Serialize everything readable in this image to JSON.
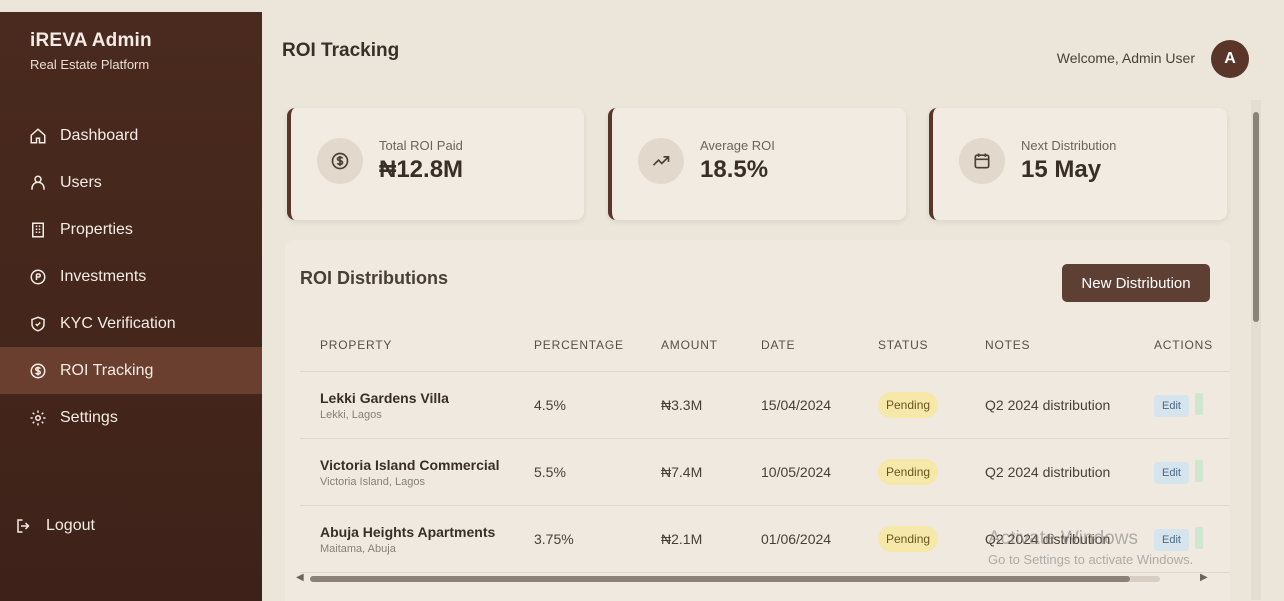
{
  "sidebar": {
    "brand_title": "iREVA Admin",
    "brand_subtitle": "Real Estate Platform",
    "items": [
      {
        "label": "Dashboard",
        "icon": "home-icon"
      },
      {
        "label": "Users",
        "icon": "users-icon"
      },
      {
        "label": "Properties",
        "icon": "building-icon"
      },
      {
        "label": "Investments",
        "icon": "coin-icon"
      },
      {
        "label": "KYC Verification",
        "icon": "shield-icon"
      },
      {
        "label": "ROI Tracking",
        "icon": "dollar-circle-icon",
        "active": true
      },
      {
        "label": "Settings",
        "icon": "gear-icon"
      }
    ],
    "logout_label": "Logout"
  },
  "header": {
    "title": "ROI Tracking",
    "welcome": "Welcome, Admin User",
    "avatar_initial": "A"
  },
  "stats": [
    {
      "label": "Total ROI Paid",
      "value": "₦12.8M",
      "icon": "dollar-circle-icon"
    },
    {
      "label": "Average ROI",
      "value": "18.5%",
      "icon": "trend-up-icon"
    },
    {
      "label": "Next Distribution",
      "value": "15 May",
      "icon": "calendar-icon"
    }
  ],
  "distributions": {
    "title": "ROI Distributions",
    "new_button": "New Distribution",
    "columns": [
      "PROPERTY",
      "PERCENTAGE",
      "AMOUNT",
      "DATE",
      "STATUS",
      "NOTES",
      "ACTIONS"
    ],
    "rows": [
      {
        "property": "Lekki Gardens Villa",
        "location": "Lekki, Lagos",
        "percentage": "4.5%",
        "amount": "₦3.3M",
        "date": "15/04/2024",
        "status": "Pending",
        "notes": "Q2 2024 distribution",
        "edit": "Edit"
      },
      {
        "property": "Victoria Island Commercial",
        "location": "Victoria Island, Lagos",
        "percentage": "5.5%",
        "amount": "₦7.4M",
        "date": "10/05/2024",
        "status": "Pending",
        "notes": "Q2 2024 distribution",
        "edit": "Edit"
      },
      {
        "property": "Abuja Heights Apartments",
        "location": "Maitama, Abuja",
        "percentage": "3.75%",
        "amount": "₦2.1M",
        "date": "01/06/2024",
        "status": "Pending",
        "notes": "Q2 2024 distribution",
        "edit": "Edit"
      }
    ]
  },
  "watermark": {
    "line1": "Activate Windows",
    "line2": "Go to Settings to activate Windows."
  }
}
